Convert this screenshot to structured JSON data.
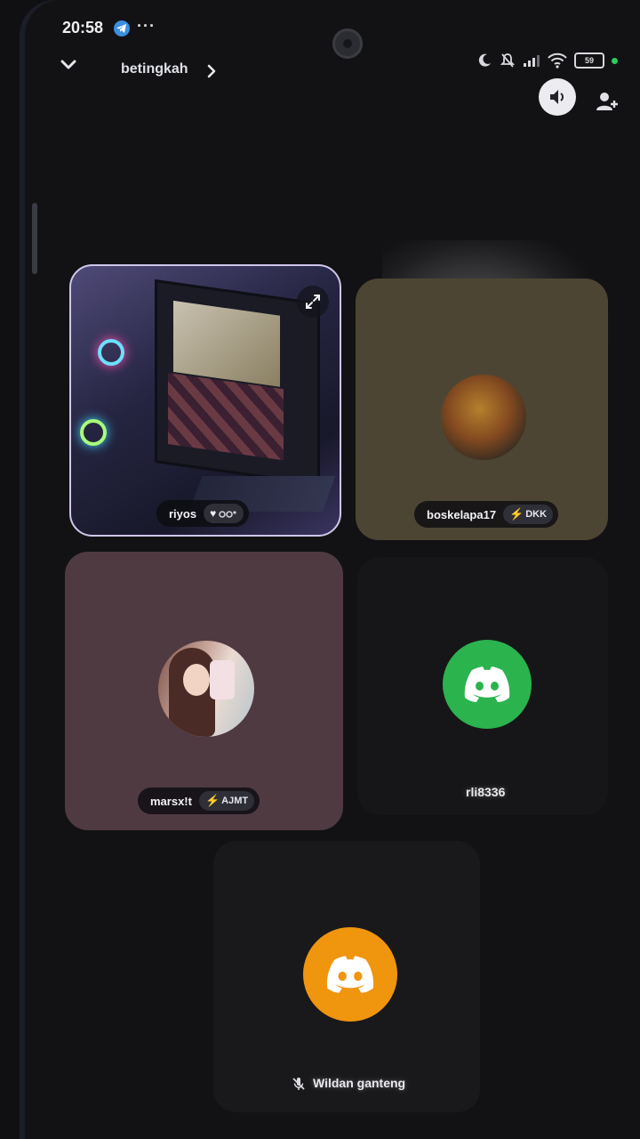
{
  "status_bar": {
    "time": "20:58",
    "more": "···",
    "battery": "59"
  },
  "header": {
    "channel_name": "betingkah"
  },
  "participants": [
    {
      "name": "riyos",
      "streaming": true
    },
    {
      "name": "boskelapa17",
      "tag": "DKK"
    },
    {
      "name": "marsx!t",
      "tag": "AJMT"
    },
    {
      "name": "rli8336"
    },
    {
      "name": "Wildan ganteng",
      "muted": true
    }
  ],
  "colors": {
    "discord_green": "#2bb34e",
    "discord_orange": "#f0950e",
    "tag_bolt": "#f3b51a"
  }
}
